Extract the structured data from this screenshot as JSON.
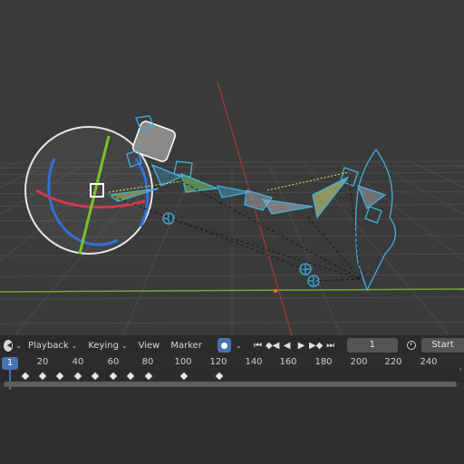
{
  "header": {
    "menus": [
      "Playback",
      "Keying",
      "View",
      "Marker"
    ],
    "current_frame": "1",
    "start_label": "Start"
  },
  "timeline": {
    "ticks": [
      "20",
      "40",
      "60",
      "80",
      "100",
      "120",
      "140",
      "160",
      "180",
      "200",
      "220",
      "240"
    ],
    "current_frame_indicator": "1",
    "keyframes": [
      10,
      20,
      30,
      40,
      50,
      60,
      70,
      80,
      100,
      120
    ]
  },
  "icons": {
    "editor_type": "timeline-editor-icon",
    "auto_key": "record-icon",
    "jump_start": "jump-start-icon",
    "prev_key": "prev-keyframe-icon",
    "play_reverse": "play-reverse-icon",
    "play": "play-icon",
    "next_key": "next-keyframe-icon",
    "jump_end": "jump-end-icon",
    "stopwatch": "stopwatch-icon"
  },
  "colors": {
    "accent": "#4772b3",
    "armature": "#3fb0e0",
    "rotate_x": "#d0384a",
    "rotate_y": "#7ac22a",
    "rotate_z": "#3070d8"
  }
}
